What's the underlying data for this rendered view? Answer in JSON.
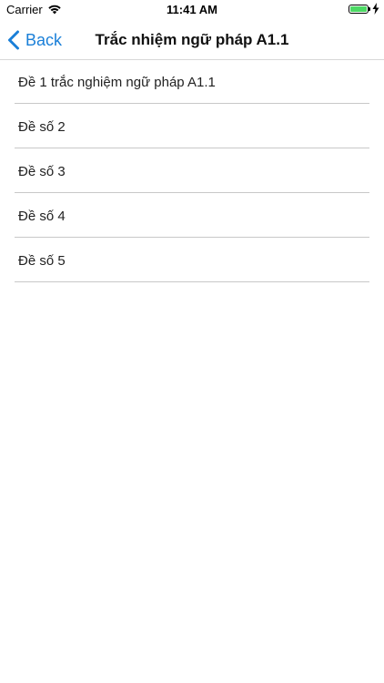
{
  "status_bar": {
    "carrier": "Carrier",
    "time": "11:41 AM",
    "battery_color": "#4cd964",
    "wifi_icon": "wifi-icon",
    "charging_icon": "charging-bolt-icon"
  },
  "nav": {
    "back_label": "Back",
    "title": "Trắc nhiệm ngữ pháp A1.1",
    "accent_color": "#1a7fd8"
  },
  "list": {
    "items": [
      {
        "label": "Đề 1 trắc nghiệm ngữ pháp A1.1"
      },
      {
        "label": "Đề số 2"
      },
      {
        "label": "Đề số 3"
      },
      {
        "label": "Đề số 4"
      },
      {
        "label": "Đề số 5"
      }
    ]
  }
}
